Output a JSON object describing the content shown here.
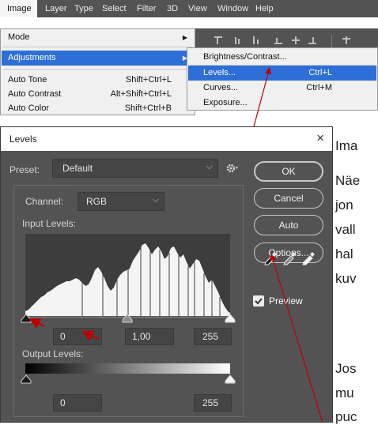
{
  "background_text": {
    "lines": [
      "Ima",
      "Näe",
      "jon",
      "vall",
      "hal",
      "kuv",
      "Jos",
      "mu",
      "puc"
    ]
  },
  "menubar": {
    "items": [
      "Image",
      "Layer",
      "Type",
      "Select",
      "Filter",
      "3D",
      "View",
      "Window",
      "Help"
    ],
    "active_index": 0
  },
  "image_menu": {
    "items": [
      {
        "label": "Mode",
        "shortcut": "",
        "submenu": true
      },
      {
        "label": "Adjustments",
        "shortcut": "",
        "submenu": true,
        "highlighted": true
      },
      {
        "label": "Auto Tone",
        "shortcut": "Shift+Ctrl+L"
      },
      {
        "label": "Auto Contrast",
        "shortcut": "Alt+Shift+Ctrl+L"
      },
      {
        "label": "Auto Color",
        "shortcut": "Shift+Ctrl+B"
      }
    ]
  },
  "adjustments_menu": {
    "items": [
      {
        "label": "Brightness/Contrast...",
        "shortcut": ""
      },
      {
        "label": "Levels...",
        "shortcut": "Ctrl+L",
        "highlighted": true
      },
      {
        "label": "Curves...",
        "shortcut": "Ctrl+M"
      },
      {
        "label": "Exposure...",
        "shortcut": ""
      }
    ]
  },
  "dialog": {
    "title": "Levels",
    "close_glyph": "×",
    "preset_label": "Preset:",
    "preset_value": "Default",
    "channel_label": "Channel:",
    "channel_value": "RGB",
    "input_levels_label": "Input Levels:",
    "input_black": "0",
    "input_gamma": "1,00",
    "input_white": "255",
    "output_levels_label": "Output Levels:",
    "output_black": "0",
    "output_white": "255",
    "buttons": {
      "ok": "OK",
      "cancel": "Cancel",
      "auto": "Auto",
      "options": "Options..."
    },
    "preview_label": "Preview",
    "preview_checked": true
  },
  "colors": {
    "ps_panel": "#535353",
    "menu_highlight": "#2d6fd6",
    "annotation_arrow": "#c00000"
  }
}
